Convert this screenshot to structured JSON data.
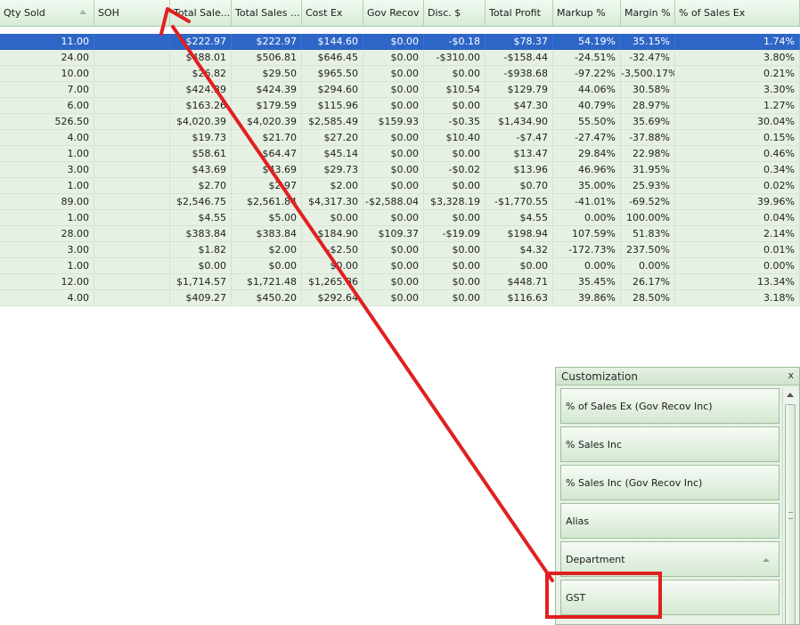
{
  "grid": {
    "columns": [
      {
        "key": "qty_sold",
        "label": "Qty Sold"
      },
      {
        "key": "soh",
        "label": "SOH"
      },
      {
        "key": "total_sales_ex",
        "label": "Total Sale..."
      },
      {
        "key": "total_sales_inc",
        "label": "Total Sales ..."
      },
      {
        "key": "cost_ex",
        "label": "Cost Ex"
      },
      {
        "key": "gov_recov",
        "label": "Gov Recov"
      },
      {
        "key": "disc",
        "label": "Disc. $"
      },
      {
        "key": "total_profit",
        "label": "Total Profit"
      },
      {
        "key": "markup",
        "label": "Markup %"
      },
      {
        "key": "margin",
        "label": "Margin %"
      },
      {
        "key": "pct_sales_ex",
        "label": "% of Sales Ex"
      }
    ],
    "sort_icon": "sort-ascending-icon",
    "selected_row": 0,
    "rows": [
      [
        "11.00",
        "",
        "$222.97",
        "$222.97",
        "$144.60",
        "$0.00",
        "-$0.18",
        "$78.37",
        "54.19%",
        "35.15%",
        "1.74%"
      ],
      [
        "24.00",
        "",
        "$488.01",
        "$506.81",
        "$646.45",
        "$0.00",
        "-$310.00",
        "-$158.44",
        "-24.51%",
        "-32.47%",
        "3.80%"
      ],
      [
        "10.00",
        "",
        "$26.82",
        "$29.50",
        "$965.50",
        "$0.00",
        "$0.00",
        "-$938.68",
        "-97.22%",
        "-3,500.17%",
        "0.21%"
      ],
      [
        "7.00",
        "",
        "$424.39",
        "$424.39",
        "$294.60",
        "$0.00",
        "$10.54",
        "$129.79",
        "44.06%",
        "30.58%",
        "3.30%"
      ],
      [
        "6.00",
        "",
        "$163.26",
        "$179.59",
        "$115.96",
        "$0.00",
        "$0.00",
        "$47.30",
        "40.79%",
        "28.97%",
        "1.27%"
      ],
      [
        "526.50",
        "",
        "$4,020.39",
        "$4,020.39",
        "$2,585.49",
        "$159.93",
        "-$0.35",
        "$1,434.90",
        "55.50%",
        "35.69%",
        "30.04%"
      ],
      [
        "4.00",
        "",
        "$19.73",
        "$21.70",
        "$27.20",
        "$0.00",
        "$10.40",
        "-$7.47",
        "-27.47%",
        "-37.88%",
        "0.15%"
      ],
      [
        "1.00",
        "",
        "$58.61",
        "$64.47",
        "$45.14",
        "$0.00",
        "$0.00",
        "$13.47",
        "29.84%",
        "22.98%",
        "0.46%"
      ],
      [
        "3.00",
        "",
        "$43.69",
        "$43.69",
        "$29.73",
        "$0.00",
        "-$0.02",
        "$13.96",
        "46.96%",
        "31.95%",
        "0.34%"
      ],
      [
        "1.00",
        "",
        "$2.70",
        "$2.97",
        "$2.00",
        "$0.00",
        "$0.00",
        "$0.70",
        "35.00%",
        "25.93%",
        "0.02%"
      ],
      [
        "89.00",
        "",
        "$2,546.75",
        "$2,561.84",
        "$4,317.30",
        "-$2,588.04",
        "$3,328.19",
        "-$1,770.55",
        "-41.01%",
        "-69.52%",
        "39.96%"
      ],
      [
        "1.00",
        "",
        "$4.55",
        "$5.00",
        "$0.00",
        "$0.00",
        "$0.00",
        "$4.55",
        "0.00%",
        "100.00%",
        "0.04%"
      ],
      [
        "28.00",
        "",
        "$383.84",
        "$383.84",
        "$184.90",
        "$109.37",
        "-$19.09",
        "$198.94",
        "107.59%",
        "51.83%",
        "2.14%"
      ],
      [
        "3.00",
        "",
        "$1.82",
        "$2.00",
        "-$2.50",
        "$0.00",
        "$0.00",
        "$4.32",
        "-172.73%",
        "237.50%",
        "0.01%"
      ],
      [
        "1.00",
        "",
        "$0.00",
        "$0.00",
        "$0.00",
        "$0.00",
        "$0.00",
        "$0.00",
        "0.00%",
        "0.00%",
        "0.00%"
      ],
      [
        "12.00",
        "",
        "$1,714.57",
        "$1,721.48",
        "$1,265.86",
        "$0.00",
        "$0.00",
        "$448.71",
        "35.45%",
        "26.17%",
        "13.34%"
      ],
      [
        "4.00",
        "",
        "$409.27",
        "$450.20",
        "$292.64",
        "$0.00",
        "$0.00",
        "$116.63",
        "39.86%",
        "28.50%",
        "3.18%"
      ]
    ]
  },
  "customization": {
    "title": "Customization",
    "close_icon": "close-icon",
    "close_glyph": "x",
    "items": [
      {
        "label": "% of Sales Ex (Gov Recov Inc)"
      },
      {
        "label": "% Sales Inc"
      },
      {
        "label": "% Sales Inc (Gov Recov Inc)"
      },
      {
        "label": "Alias"
      },
      {
        "label": "Department",
        "icon": "chevron-up-icon"
      },
      {
        "label": "GST"
      }
    ]
  },
  "annotation": {
    "color": "#e02020",
    "highlighted_item": "GST"
  }
}
